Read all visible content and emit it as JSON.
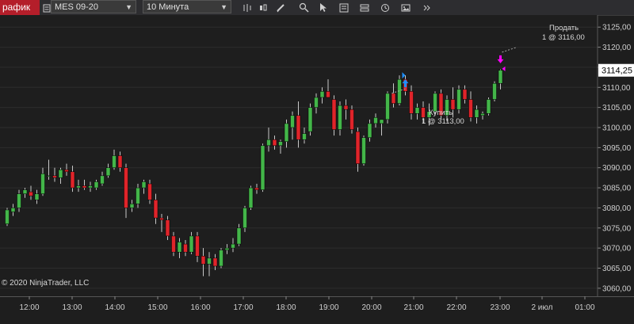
{
  "toolbar": {
    "tab_label": "рафик",
    "instrument": "MES 09-20",
    "interval": "10 Минута",
    "tools": [
      "bar-chart-icon",
      "candlestick-icon",
      "pencil-icon",
      "magnifier-icon",
      "cursor-icon",
      "list-icon",
      "rows-icon",
      "clock-icon",
      "image-icon",
      "chevron-icon"
    ]
  },
  "copyright": "© 2020 NinjaTrader, LLC",
  "trades": {
    "buy_label": "Купить",
    "buy_detail": "1 @ 3113,00",
    "sell_label": "Продать",
    "sell_detail": "1 @ 3116,00"
  },
  "colors": {
    "up": "#43b649",
    "down": "#e0242a",
    "background": "#1e1e1e",
    "grid": "#2d2d2d",
    "buy_marker": "#1e90ff",
    "sell_marker": "#ff00ff",
    "last_price_bg": "#ffffff"
  },
  "chart_data": {
    "type": "candlestick",
    "ylim": [
      3058,
      3128
    ],
    "y_ticks": [
      "3060,00",
      "3065,00",
      "3070,00",
      "3075,00",
      "3080,00",
      "3085,00",
      "3090,00",
      "3095,00",
      "3100,00",
      "3105,00",
      "3110,00",
      "3115,00",
      "3120,00",
      "3125,00"
    ],
    "last_price": "3114,25",
    "x_ticks": [
      "12:00",
      "13:00",
      "14:00",
      "15:00",
      "16:00",
      "17:00",
      "18:00",
      "19:00",
      "20:00",
      "21:00",
      "22:00",
      "23:00",
      "2 июл",
      "01:00"
    ],
    "ohlc": [
      [
        3076.0,
        3080.0,
        3075.5,
        3079.5
      ],
      [
        3079.0,
        3081.0,
        3078.0,
        3080.0
      ],
      [
        3080.0,
        3084.5,
        3079.0,
        3083.5
      ],
      [
        3083.5,
        3085.0,
        3082.5,
        3084.5
      ],
      [
        3084.0,
        3085.5,
        3082.0,
        3083.0
      ],
      [
        3082.0,
        3084.5,
        3081.0,
        3083.5
      ],
      [
        3083.5,
        3090.0,
        3083.0,
        3088.5
      ],
      [
        3088.0,
        3092.0,
        3087.0,
        3088.0
      ],
      [
        3088.0,
        3090.0,
        3086.5,
        3087.5
      ],
      [
        3087.5,
        3090.0,
        3086.0,
        3089.5
      ],
      [
        3089.5,
        3091.0,
        3088.0,
        3089.0
      ],
      [
        3089.0,
        3090.5,
        3084.0,
        3085.0
      ],
      [
        3085.0,
        3087.0,
        3084.0,
        3085.5
      ],
      [
        3085.5,
        3087.0,
        3084.5,
        3085.0
      ],
      [
        3085.0,
        3086.5,
        3084.0,
        3085.5
      ],
      [
        3085.0,
        3087.0,
        3084.5,
        3086.5
      ],
      [
        3086.0,
        3089.0,
        3085.5,
        3088.0
      ],
      [
        3088.0,
        3091.0,
        3087.5,
        3090.0
      ],
      [
        3090.0,
        3094.5,
        3089.5,
        3093.0
      ],
      [
        3093.0,
        3094.0,
        3089.0,
        3090.0
      ],
      [
        3090.0,
        3091.0,
        3077.5,
        3080.0
      ],
      [
        3080.0,
        3082.0,
        3079.0,
        3081.0
      ],
      [
        3081.0,
        3086.0,
        3080.0,
        3085.0
      ],
      [
        3085.0,
        3087.0,
        3083.5,
        3086.5
      ],
      [
        3086.0,
        3087.0,
        3081.0,
        3082.0
      ],
      [
        3082.0,
        3083.5,
        3076.0,
        3077.5
      ],
      [
        3077.5,
        3078.5,
        3074.0,
        3077.0
      ],
      [
        3077.0,
        3078.0,
        3072.0,
        3073.0
      ],
      [
        3073.0,
        3074.0,
        3068.0,
        3069.0
      ],
      [
        3069.0,
        3072.5,
        3067.5,
        3071.5
      ],
      [
        3071.0,
        3072.0,
        3068.0,
        3069.0
      ],
      [
        3069.0,
        3074.0,
        3068.5,
        3073.0
      ],
      [
        3073.0,
        3074.0,
        3066.5,
        3068.0
      ],
      [
        3068.0,
        3070.0,
        3063.0,
        3066.0
      ],
      [
        3066.0,
        3069.0,
        3063.0,
        3067.5
      ],
      [
        3067.5,
        3068.5,
        3064.5,
        3065.5
      ],
      [
        3065.5,
        3070.0,
        3065.0,
        3069.5
      ],
      [
        3069.5,
        3071.0,
        3068.5,
        3070.0
      ],
      [
        3070.0,
        3072.5,
        3069.0,
        3071.0
      ],
      [
        3071.0,
        3076.0,
        3070.5,
        3075.0
      ],
      [
        3075.0,
        3080.5,
        3074.0,
        3080.0
      ],
      [
        3080.0,
        3085.5,
        3079.5,
        3085.0
      ],
      [
        3085.0,
        3086.0,
        3083.5,
        3084.5
      ],
      [
        3084.5,
        3096.0,
        3084.0,
        3095.5
      ],
      [
        3095.5,
        3100.0,
        3094.0,
        3097.0
      ],
      [
        3097.0,
        3098.0,
        3094.5,
        3095.5
      ],
      [
        3095.5,
        3097.0,
        3093.5,
        3096.5
      ],
      [
        3096.5,
        3102.0,
        3095.0,
        3101.0
      ],
      [
        3100.0,
        3104.0,
        3097.0,
        3103.0
      ],
      [
        3103.0,
        3106.5,
        3095.0,
        3097.0
      ],
      [
        3097.0,
        3100.0,
        3096.0,
        3098.5
      ],
      [
        3099.0,
        3106.0,
        3098.0,
        3105.0
      ],
      [
        3105.0,
        3108.5,
        3103.5,
        3107.5
      ],
      [
        3107.5,
        3110.0,
        3106.0,
        3109.0
      ],
      [
        3109.0,
        3112.0,
        3108.0,
        3107.5
      ],
      [
        3107.0,
        3108.0,
        3098.0,
        3099.5
      ],
      [
        3099.5,
        3106.5,
        3098.0,
        3105.5
      ],
      [
        3105.5,
        3107.0,
        3102.0,
        3104.5
      ],
      [
        3104.5,
        3105.5,
        3098.5,
        3099.5
      ],
      [
        3099.0,
        3100.0,
        3089.0,
        3091.0
      ],
      [
        3091.0,
        3098.0,
        3090.5,
        3097.5
      ],
      [
        3097.5,
        3102.0,
        3096.5,
        3101.0
      ],
      [
        3101.0,
        3103.5,
        3100.0,
        3102.5
      ],
      [
        3101.0,
        3102.0,
        3098.0,
        3102.0
      ],
      [
        3102.0,
        3109.0,
        3101.0,
        3108.5
      ],
      [
        3108.5,
        3111.0,
        3105.0,
        3106.0
      ],
      [
        3106.0,
        3113.0,
        3105.5,
        3112.0
      ],
      [
        3112.0,
        3113.0,
        3108.0,
        3109.0
      ],
      [
        3109.0,
        3110.5,
        3102.0,
        3103.5
      ],
      [
        3103.5,
        3106.0,
        3102.0,
        3105.0
      ],
      [
        3105.0,
        3106.5,
        3101.0,
        3102.5
      ],
      [
        3102.5,
        3106.0,
        3100.5,
        3104.0
      ],
      [
        3104.0,
        3109.0,
        3103.0,
        3108.5
      ],
      [
        3108.5,
        3109.5,
        3102.0,
        3103.0
      ],
      [
        3103.0,
        3108.0,
        3101.5,
        3107.0
      ],
      [
        3107.0,
        3110.0,
        3102.5,
        3104.5
      ],
      [
        3104.5,
        3110.5,
        3103.5,
        3109.5
      ],
      [
        3109.5,
        3110.5,
        3106.0,
        3107.0
      ],
      [
        3107.0,
        3109.0,
        3101.5,
        3102.5
      ],
      [
        3102.5,
        3105.5,
        3101.0,
        3104.5
      ],
      [
        3103.0,
        3104.0,
        3102.0,
        3103.5
      ],
      [
        3103.5,
        3107.5,
        3103.0,
        3107.0
      ],
      [
        3107.0,
        3111.5,
        3106.5,
        3111.0
      ],
      [
        3111.0,
        3114.5,
        3109.5,
        3114.25
      ]
    ],
    "buy_index": 67,
    "buy_price": 3113.0,
    "sell_index": 83,
    "sell_price": 3116.0
  }
}
